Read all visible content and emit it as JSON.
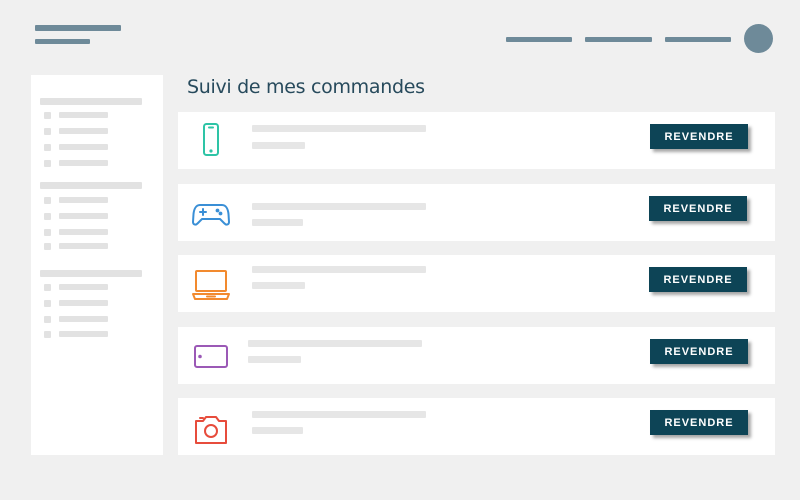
{
  "page": {
    "title": "Suivi de mes commandes"
  },
  "orders": [
    {
      "icon": "smartphone-icon",
      "color": "#2ec4a6",
      "action_label": "REVENDRE"
    },
    {
      "icon": "gamepad-icon",
      "color": "#3a8fd6",
      "action_label": "REVENDRE"
    },
    {
      "icon": "laptop-icon",
      "color": "#f28a2e",
      "action_label": "REVENDRE"
    },
    {
      "icon": "tablet-icon",
      "color": "#9b59b6",
      "action_label": "REVENDRE"
    },
    {
      "icon": "camera-icon",
      "color": "#e74c3c",
      "action_label": "REVENDRE"
    }
  ],
  "colors": {
    "background": "#f0f0f0",
    "accent": "#0d4456",
    "title_text": "#274a5c",
    "header_bars": "#6e8a99",
    "placeholder": "#e6e6e6"
  }
}
